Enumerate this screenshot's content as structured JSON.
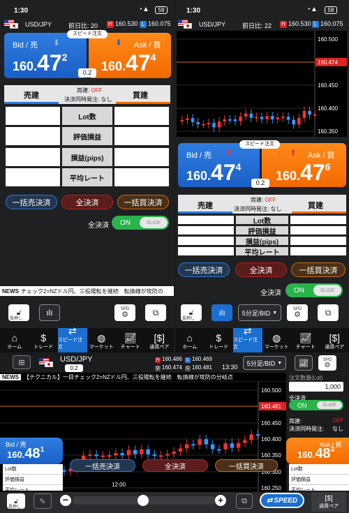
{
  "s1": {
    "time": "1:30",
    "signal": "▾◢",
    "battery": "58",
    "pair": "USD/JPY",
    "prev": "前日比: 20",
    "high": "160.530",
    "low": "160.075",
    "speed_order": "スピード注文",
    "bid_label": "Bid / 売",
    "ask_label": "Ask / 買",
    "bid_main": "160.",
    "bid_big": "47",
    "bid_sup": "2",
    "ask_main": "160.",
    "ask_big": "47",
    "ask_sup": "4",
    "spread": "0.2",
    "sell_tab": "売建",
    "buy_tab": "買建",
    "both": "両建:",
    "both_val": "OFF",
    "settle": "決済同時発注: なし",
    "rows": [
      "Lot数",
      "評価損益",
      "損益(pips)",
      "平均レート"
    ],
    "btn_sell": "一括売決済",
    "btn_all": "全決済",
    "btn_buy": "一括買決済",
    "allset": "全決済",
    "on": "ON",
    "slide": "SLIDE",
    "news": "NEWS",
    "news_text": "チェック2=NZドル円、三役陽転を継続　転換線が攻防の",
    "long": "長押し",
    "spd": "SPD"
  },
  "s2": {
    "time": "1:30",
    "battery": "58",
    "pair": "USD/JPY",
    "prev": "前日比: 22",
    "high": "160.530",
    "low": "160.075",
    "ticks": [
      "160.500",
      "160.474",
      "160.450",
      "160.400",
      "160.350"
    ],
    "speed_order": "スピード注文",
    "bid_label": "Bid / 売",
    "ask_label": "Ask / 買",
    "bid_main": "160.",
    "bid_big": "47",
    "bid_sup": "4",
    "ask_main": "160.",
    "ask_big": "47",
    "ask_sup": "6",
    "spread": "0.2",
    "sell_tab": "売建",
    "buy_tab": "買建",
    "both": "両建:",
    "both_val": "OFF",
    "settle": "決済同時発注: なし",
    "rows": [
      "Lot数",
      "評価損益",
      "損益(pips)",
      "平均レート"
    ],
    "btn_sell": "一括売決済",
    "btn_all": "全決済",
    "btn_buy": "一括買決済",
    "allset": "全決済",
    "on": "ON",
    "slide": "SLIDE",
    "long": "長押し",
    "timeframe": "5分足/BID",
    "spd": "SPD"
  },
  "nav": [
    "ホーム",
    "トレード",
    "スピード注文",
    "マーケット",
    "チャート",
    "通貨ペア"
  ],
  "s3": {
    "pair": "USD/JPY",
    "spread": "0.2",
    "h": "160.486",
    "l": "160.469",
    "o": "160.474",
    "c": "160.481",
    "time": "13:30",
    "timeframe": "5分足/BID",
    "spd": "SPD",
    "news": "NEWS",
    "news_text": "【テクニカル】一目チェック2=NZドル円、三役陽転を継続　転換線が攻防の分岐点",
    "ticks": [
      "160.500",
      "160.481",
      "160.450",
      "160.400",
      "160.350",
      "160.300",
      "160.250"
    ],
    "xtime": "12:00",
    "qty_label": "注文数量(Lot)",
    "qty": "1,000",
    "allset": "全決済",
    "on": "ON",
    "slide": "SLIDE",
    "both": "両建:",
    "both_val": "OFF",
    "settle": "決済同時発注:",
    "settle_val": "なし",
    "bid_label": "Bid / 売",
    "bid_main": "160.",
    "bid_big": "48",
    "bid_sup": "1",
    "ask_label": "Ask / 買",
    "ask_main": "160.",
    "ask_big": "48",
    "ask_sup": "3",
    "rows": [
      "Lot数",
      "評価損益",
      "平均レート"
    ],
    "btn_sell": "一括売決済",
    "btn_all": "全決済",
    "btn_buy": "一括買決済",
    "long": "長押し",
    "speed": "SPEED",
    "pairs": "通貨ペア"
  }
}
